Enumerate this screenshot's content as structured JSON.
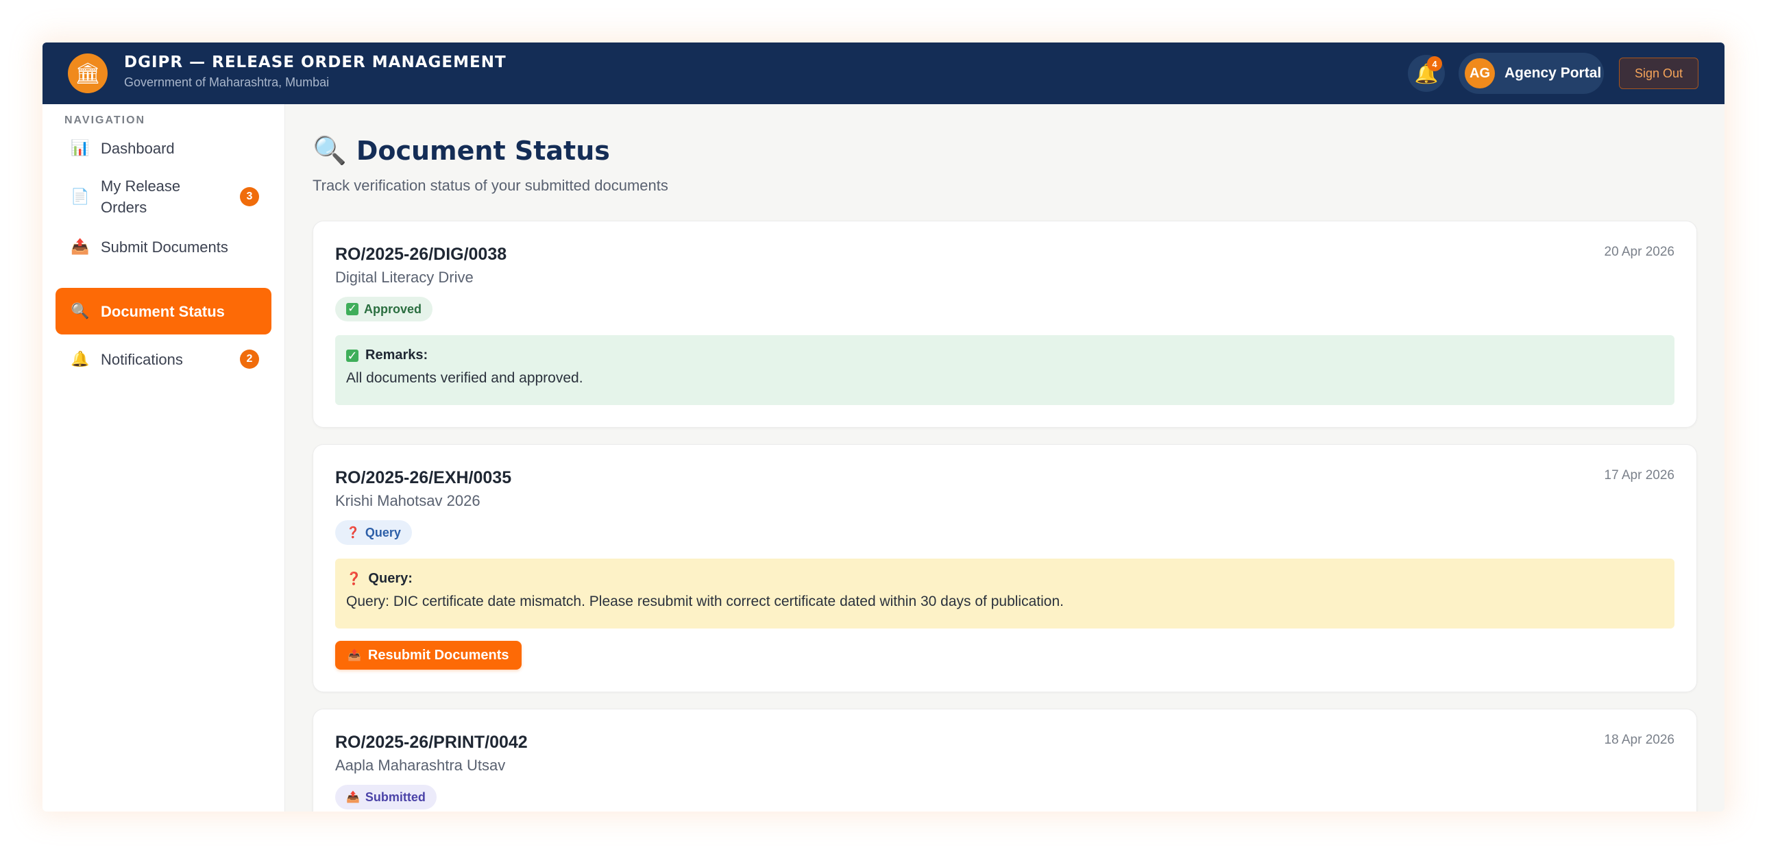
{
  "header": {
    "logo_icon": "🏛",
    "title": "DGIPR — RELEASE ORDER MANAGEMENT",
    "subtitle": "Government of Maharashtra, Mumbai",
    "notification_count": "4",
    "user_initials": "AG",
    "user_label": "Agency Portal",
    "signout_label": "Sign Out"
  },
  "sidebar": {
    "heading": "NAVIGATION",
    "items": [
      {
        "icon": "📊",
        "label": "Dashboard",
        "badge": ""
      },
      {
        "icon": "📄",
        "label": "My Release Orders",
        "badge": "3"
      },
      {
        "icon": "📤",
        "label": "Submit Documents",
        "badge": ""
      },
      {
        "icon": "🔍",
        "label": "Document Status",
        "badge": "",
        "active": true
      },
      {
        "icon": "🔔",
        "label": "Notifications",
        "badge": "2"
      }
    ]
  },
  "main": {
    "title_icon": "🔍",
    "title": "Document Status",
    "subtitle": "Track verification status of your submitted documents",
    "cards": [
      {
        "ro": "RO/2025-26/DIG/0038",
        "date": "20 Apr 2026",
        "name": "Digital Literacy Drive",
        "status": "Approved",
        "remark_title": "Remarks:",
        "remark_text": "All documents verified and approved."
      },
      {
        "ro": "RO/2025-26/EXH/0035",
        "date": "17 Apr 2026",
        "name": "Krishi Mahotsav 2026",
        "status": "Query",
        "remark_title": "Query:",
        "remark_text": "Query: DIC certificate date mismatch. Please resubmit with correct certificate dated within 30 days of publication.",
        "action_label": "Resubmit Documents"
      },
      {
        "ro": "RO/2025-26/PRINT/0042",
        "date": "18 Apr 2026",
        "name": "Aapla Maharashtra Utsav",
        "status": "Submitted"
      }
    ]
  },
  "colors": {
    "header_bg": "#142d56",
    "accent": "#fd6a06",
    "approved_bg": "#e5f4ea",
    "query_bg": "#fdf2c7"
  }
}
